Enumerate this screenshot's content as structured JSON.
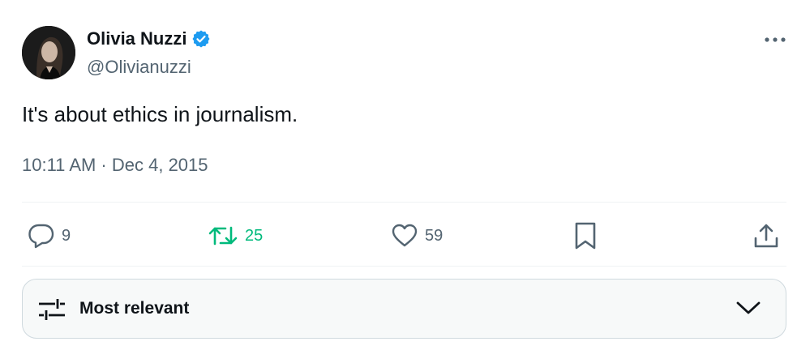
{
  "tweet": {
    "author_name": "Olivia Nuzzi",
    "handle": "@Olivianuzzi",
    "verified": true,
    "text": "It's about ethics in journalism.",
    "timestamp": "10:11 AM · Dec 4, 2015"
  },
  "actions": {
    "replies": "9",
    "reposts": "25",
    "likes": "59"
  },
  "sort": {
    "label": "Most relevant"
  },
  "colors": {
    "text": "#0f1419",
    "secondary": "#536471",
    "verified_blue": "#1d9bf0",
    "repost_green": "#00ba7c"
  },
  "icons": [
    "avatar",
    "verified-badge-icon",
    "more-icon",
    "reply-icon",
    "repost-icon",
    "like-icon",
    "bookmark-icon",
    "share-icon",
    "sort-sliders-icon",
    "chevron-down-icon"
  ]
}
